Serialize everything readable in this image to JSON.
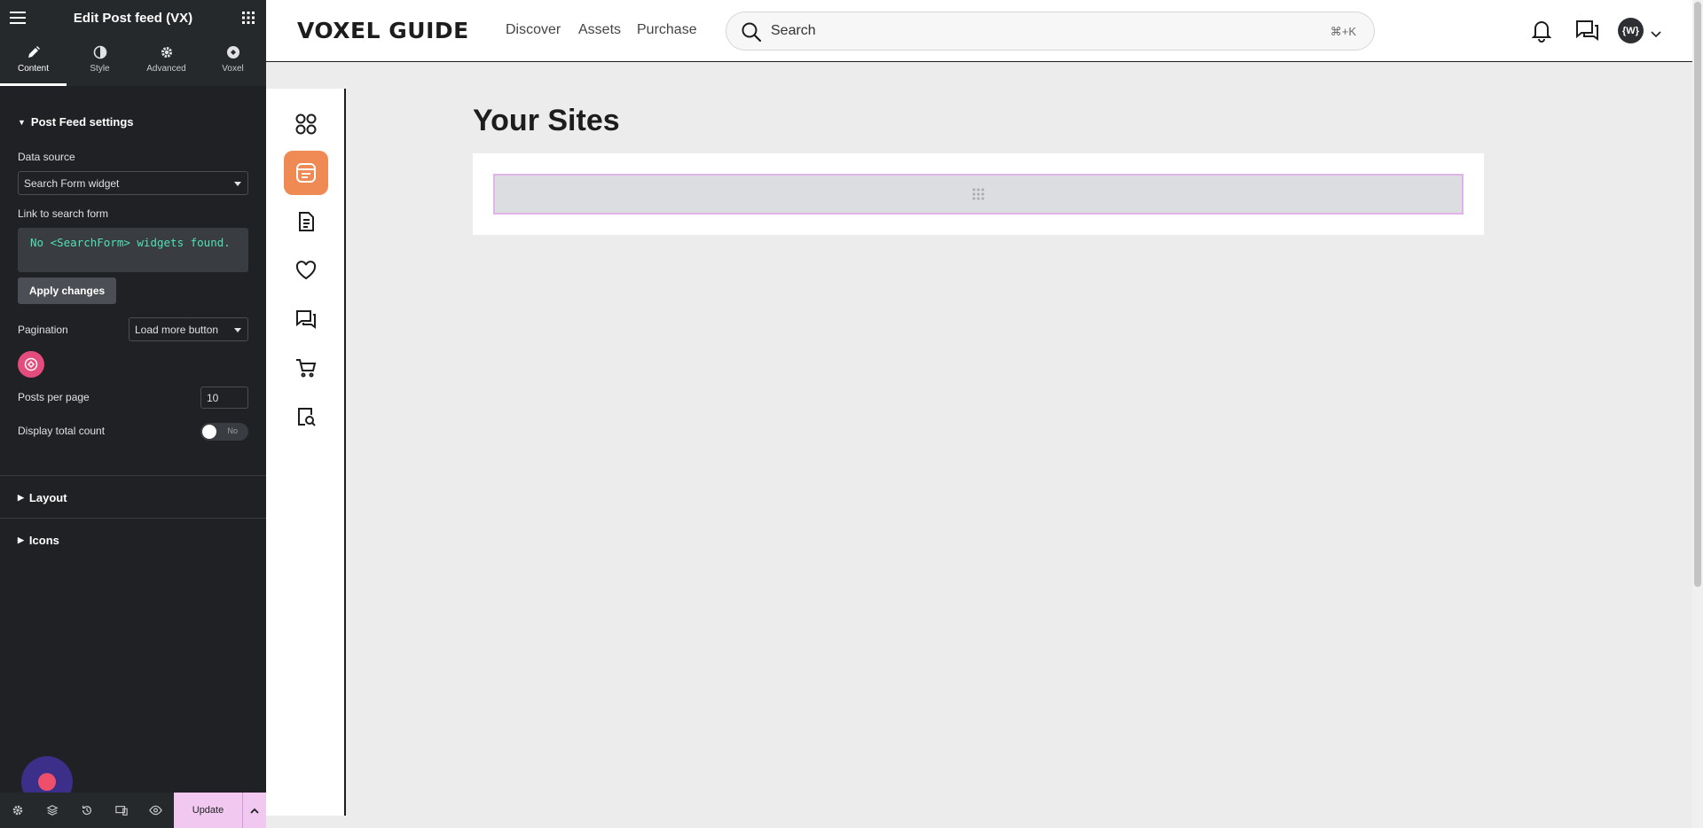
{
  "panel": {
    "title": "Edit Post feed (VX)",
    "tabs": [
      {
        "label": "Content",
        "icon": "pencil-icon",
        "active": true
      },
      {
        "label": "Style",
        "icon": "contrast-icon"
      },
      {
        "label": "Advanced",
        "icon": "gear-icon"
      },
      {
        "label": "Voxel",
        "icon": "voxel-icon"
      }
    ],
    "section_post_feed": "Post Feed settings",
    "data_source": {
      "label": "Data source",
      "value": "Search Form widget"
    },
    "link_search_form": {
      "label": "Link to search form",
      "code": "No <SearchForm> widgets found.",
      "apply": "Apply changes"
    },
    "pagination": {
      "label": "Pagination",
      "value": "Load more button"
    },
    "posts_per_page": {
      "label": "Posts per page",
      "value": "10"
    },
    "display_total": {
      "label": "Display total count",
      "toggle": "No"
    },
    "section_layout": "Layout",
    "section_icons": "Icons",
    "footer": {
      "update": "Update"
    }
  },
  "site": {
    "logo": "VOXEL GUIDE",
    "nav": [
      "Discover",
      "Assets",
      "Purchase"
    ],
    "search": {
      "placeholder": "Search",
      "shortcut": "⌘+K"
    },
    "avatar": "{W}",
    "page_title": "Your Sites"
  },
  "colors": {
    "panel_bg": "#1f2124",
    "accent_orange": "#f08a55",
    "update_pink": "#f0c8f0",
    "code_green": "#4fe0b8"
  }
}
